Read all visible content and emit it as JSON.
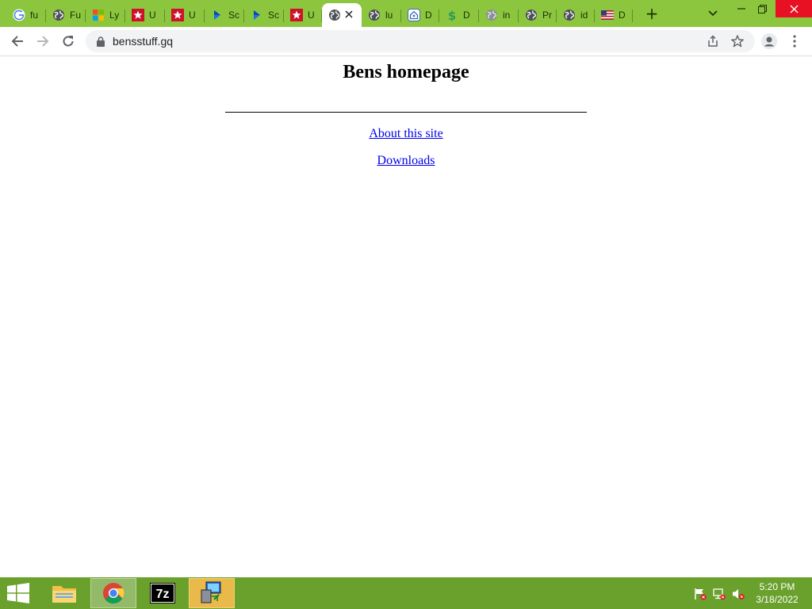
{
  "browser": {
    "tabs": [
      {
        "title": "fu",
        "icon": "google-icon"
      },
      {
        "title": "Fu",
        "icon": "globe-icon"
      },
      {
        "title": "Ly",
        "icon": "microsoft-icon"
      },
      {
        "title": "U",
        "icon": "red-star-icon"
      },
      {
        "title": "U",
        "icon": "red-star-icon"
      },
      {
        "title": "Sc",
        "icon": "blue-chevron-icon"
      },
      {
        "title": "Sc",
        "icon": "blue-chevron-icon"
      },
      {
        "title": "U",
        "icon": "red-star-icon"
      },
      {
        "title": "",
        "icon": "globe-icon",
        "active": true
      },
      {
        "title": "lu",
        "icon": "globe-icon"
      },
      {
        "title": "D",
        "icon": "home-outline-icon"
      },
      {
        "title": "D",
        "icon": "dollar-icon"
      },
      {
        "title": "in",
        "icon": "globe-gray-icon"
      },
      {
        "title": "Pr",
        "icon": "globe-icon"
      },
      {
        "title": "id",
        "icon": "globe-icon"
      },
      {
        "title": "D",
        "icon": "us-flag-icon"
      }
    ],
    "new_tab_label": "+",
    "address": {
      "url": "bensstuff.gq"
    },
    "colors": {
      "frame": "#8cc63f",
      "taskbar": "#6aa02c",
      "link": "#0000ee",
      "close": "#e81123"
    }
  },
  "page": {
    "title": "Bens homepage",
    "links": [
      {
        "label": "About this site"
      },
      {
        "label": "Downloads"
      }
    ]
  },
  "taskbar": {
    "apps": [
      "file-explorer-icon",
      "chrome-icon",
      "7zip-icon",
      "network-setup-icon"
    ],
    "clock": {
      "time": "5:20 PM",
      "date": "3/18/2022"
    }
  }
}
